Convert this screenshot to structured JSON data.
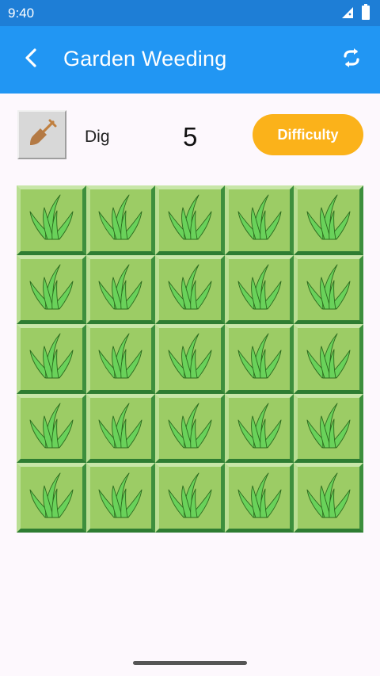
{
  "status_bar": {
    "time": "9:40",
    "signal_icon": "signal-icon",
    "battery_icon": "battery-icon"
  },
  "app_bar": {
    "title": "Garden Weeding",
    "back_icon": "back-arrow-icon",
    "refresh_icon": "refresh-icon",
    "color": "#2196f3"
  },
  "toolbar": {
    "dig_icon": "shovel-icon",
    "dig_label": "Dig",
    "count": "5",
    "difficulty_label": "Difficulty",
    "difficulty_color": "#fbb21a"
  },
  "board": {
    "rows": 5,
    "cols": 5,
    "tiles": [
      [
        "grass",
        "grass",
        "grass",
        "grass",
        "grass"
      ],
      [
        "grass",
        "grass",
        "grass",
        "grass",
        "grass"
      ],
      [
        "grass",
        "grass",
        "grass",
        "grass",
        "grass"
      ],
      [
        "grass",
        "grass",
        "grass",
        "grass",
        "grass"
      ],
      [
        "grass",
        "grass",
        "grass",
        "grass",
        "grass"
      ]
    ],
    "tile_color": "#9ccc65",
    "grass_color": "#69d25a"
  }
}
